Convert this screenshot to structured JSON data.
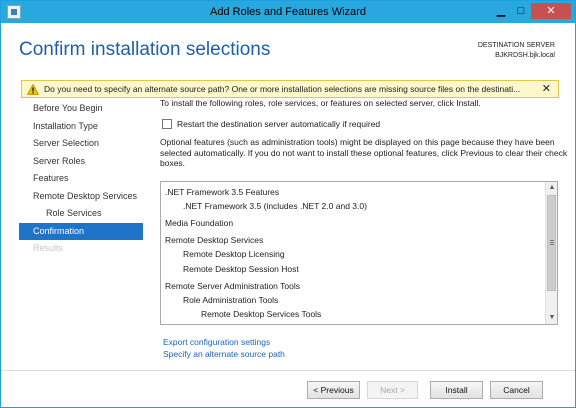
{
  "window": {
    "title": "Add Roles and Features Wizard",
    "minimize_glyph": "▁",
    "maximize_glyph": "□",
    "close_glyph": "✕"
  },
  "header": {
    "title": "Confirm installation selections",
    "destination_label": "DESTINATION SERVER",
    "destination_host": "BJKRDSH.bjk.local"
  },
  "warning": {
    "text": "Do you need to specify an alternate source path? One or more installation selections are missing source files on the destinati...",
    "close_glyph": "✕",
    "icon": "warning-icon"
  },
  "nav": {
    "items": [
      {
        "label": "Before You Begin",
        "state": "normal"
      },
      {
        "label": "Installation Type",
        "state": "normal"
      },
      {
        "label": "Server Selection",
        "state": "normal"
      },
      {
        "label": "Server Roles",
        "state": "normal"
      },
      {
        "label": "Features",
        "state": "normal"
      },
      {
        "label": "Remote Desktop Services",
        "state": "normal"
      },
      {
        "label": "Role Services",
        "state": "sub"
      },
      {
        "label": "Confirmation",
        "state": "active"
      },
      {
        "label": "Results",
        "state": "disabled"
      }
    ]
  },
  "main": {
    "intro": "To install the following roles, role services, or features on selected server, click Install.",
    "restart_label": "Restart the destination server automatically if required",
    "restart_checked": false,
    "optional_text": "Optional features (such as administration tools) might be displayed on this page because they have been selected automatically. If you do not want to install these optional features, click Previous to clear their check boxes."
  },
  "features": [
    {
      "label": ".NET Framework 3.5 Features",
      "level": 0
    },
    {
      "label": ".NET Framework 3.5 (includes .NET 2.0 and 3.0)",
      "level": 1
    },
    {
      "label": "Media Foundation",
      "level": 0
    },
    {
      "label": "Remote Desktop Services",
      "level": 0
    },
    {
      "label": "Remote Desktop Licensing",
      "level": 1
    },
    {
      "label": "Remote Desktop Session Host",
      "level": 1
    },
    {
      "label": "Remote Server Administration Tools",
      "level": 0
    },
    {
      "label": "Role Administration Tools",
      "level": 1
    },
    {
      "label": "Remote Desktop Services Tools",
      "level": 2
    }
  ],
  "links": {
    "export": "Export configuration settings",
    "alternate": "Specify an alternate source path"
  },
  "buttons": {
    "previous": "< Previous",
    "next": "Next >",
    "install": "Install",
    "cancel": "Cancel"
  },
  "scrollbar": {
    "up_glyph": "▲",
    "down_glyph": "▼"
  }
}
